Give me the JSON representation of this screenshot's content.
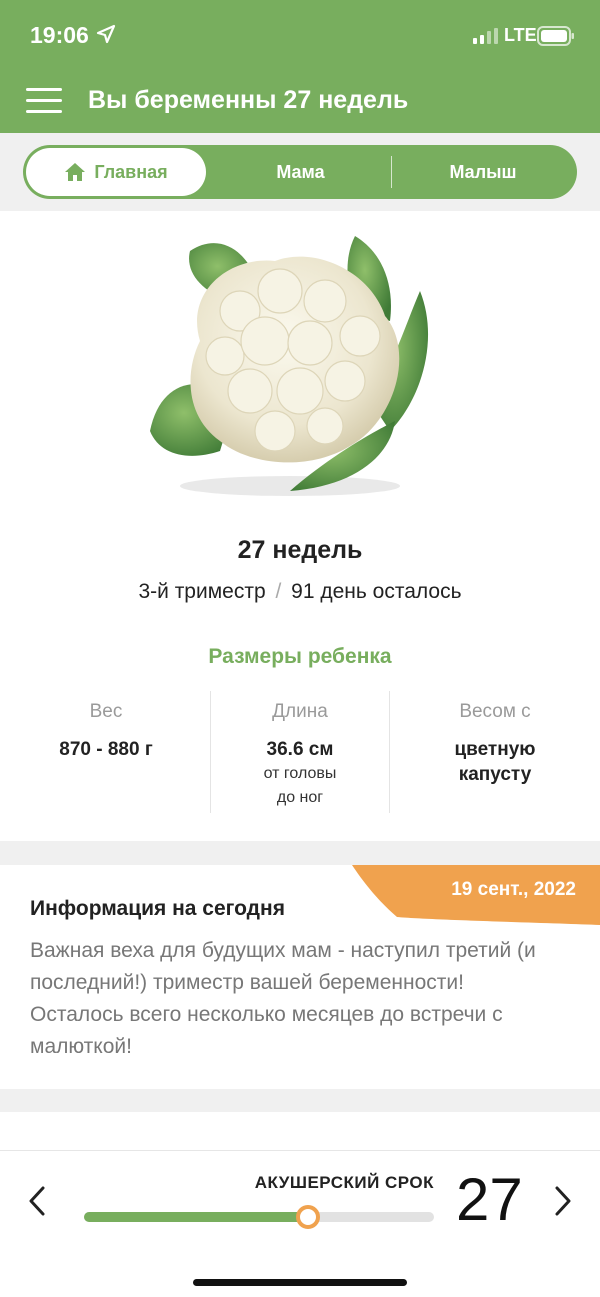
{
  "status_bar": {
    "time": "19:06",
    "network": "LTE"
  },
  "header": {
    "title": "Вы беременны 27 недель",
    "menu_icon": "hamburger-menu-icon"
  },
  "tabs": [
    {
      "label": "Главная",
      "icon": "home-icon",
      "active": true
    },
    {
      "label": "Мама",
      "active": false
    },
    {
      "label": "Малыш",
      "active": false
    }
  ],
  "week_card": {
    "image": "cauliflower",
    "weeks_title": "27 недель",
    "trimester": "3-й триместр",
    "separator": "/",
    "days_left": "91 день осталось",
    "sizes_title": "Размеры ребенка",
    "stats": [
      {
        "label": "Вес",
        "value": "870 - 880 г",
        "sub": []
      },
      {
        "label": "Длина",
        "value": "36.6 см",
        "sub": [
          "от головы",
          "до ног"
        ]
      },
      {
        "label": "Весом с",
        "value": [
          "цветную",
          "капусту"
        ],
        "sub": []
      }
    ]
  },
  "info_card": {
    "date": "19 сент., 2022",
    "title": "Информация на сегодня",
    "text": "Важная веха для будущих мам - наступил третий (и последний!) триместр вашей беременности! Осталось всего несколько месяцев до встречи с малюткой!"
  },
  "bottom_bar": {
    "label": "АКУШЕРСКИЙ СРОК",
    "week": "27",
    "progress": 0.64
  },
  "colors": {
    "primary": "#78ae5e",
    "accent": "#f0a24e"
  }
}
